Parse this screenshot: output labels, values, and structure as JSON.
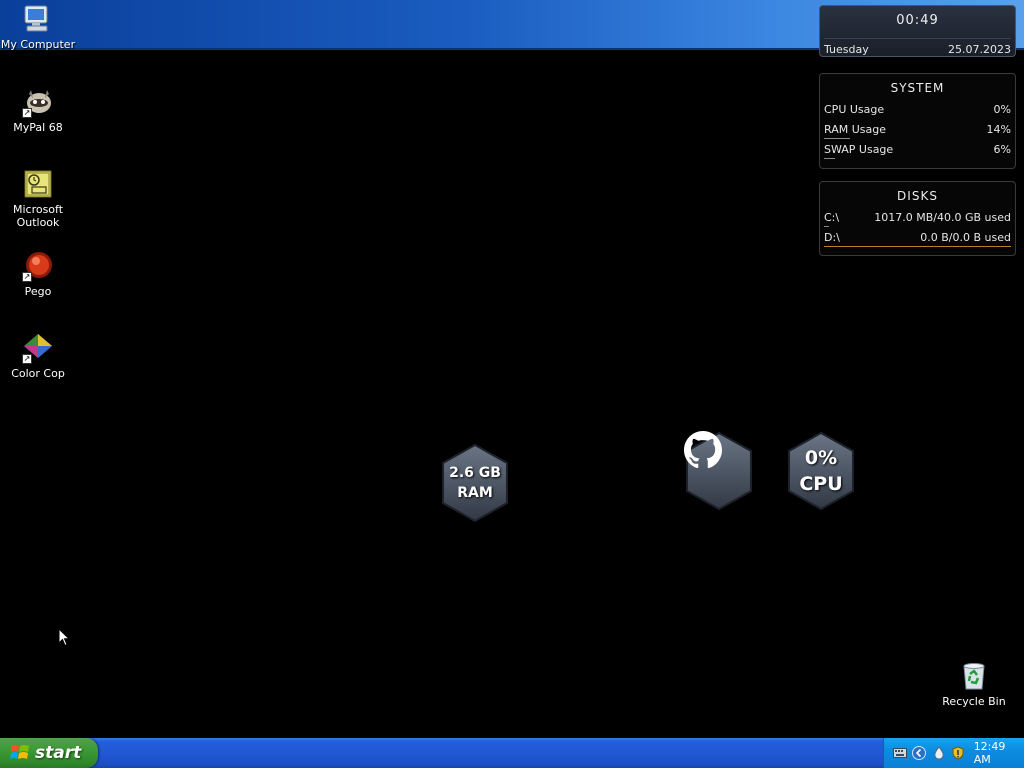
{
  "desktop_icons": [
    {
      "label": "My Computer",
      "icon": "my-computer-icon"
    },
    {
      "label": "MyPal 68",
      "icon": "mypal-icon"
    },
    {
      "label": "Microsoft Outlook",
      "icon": "outlook-icon"
    },
    {
      "label": "Pego",
      "icon": "pego-icon"
    },
    {
      "label": "Color Cop",
      "icon": "color-cop-icon"
    },
    {
      "label": "Recycle Bin",
      "icon": "recycle-bin-icon"
    }
  ],
  "clock": {
    "time": "00:49",
    "day": "Tuesday",
    "date": "25.07.2023"
  },
  "system": {
    "title": "SYSTEM",
    "rows": [
      {
        "label": "CPU Usage",
        "value": "0%",
        "fraction": 0.0
      },
      {
        "label": "RAM Usage",
        "value": "14%",
        "fraction": 0.14
      },
      {
        "label": "SWAP Usage",
        "value": "6%",
        "fraction": 0.06
      }
    ]
  },
  "disks": {
    "title": "DISKS",
    "rows": [
      {
        "label": "C:\\",
        "value": "1017.0 MB/40.0 GB used",
        "fraction": 0.025
      },
      {
        "label": "D:\\",
        "value": "0.0 B/0.0 B used",
        "fraction": 1.0
      }
    ]
  },
  "hex_widgets": {
    "ram": {
      "line1": "2.6 GB",
      "line2": "RAM"
    },
    "github": {
      "icon": "github-icon"
    },
    "cpu": {
      "line1": "0%",
      "line2": "CPU"
    }
  },
  "taskbar": {
    "start_label": "start",
    "tray_time": "12:49 AM",
    "tray_icons": [
      "keyboard-icon",
      "chevron-left-icon",
      "water-drop-icon",
      "security-shield-icon"
    ]
  },
  "colors": {
    "taskbar_blue": "#245edb",
    "start_green": "#3d9a37",
    "tray_blue": "#0c8de0"
  }
}
